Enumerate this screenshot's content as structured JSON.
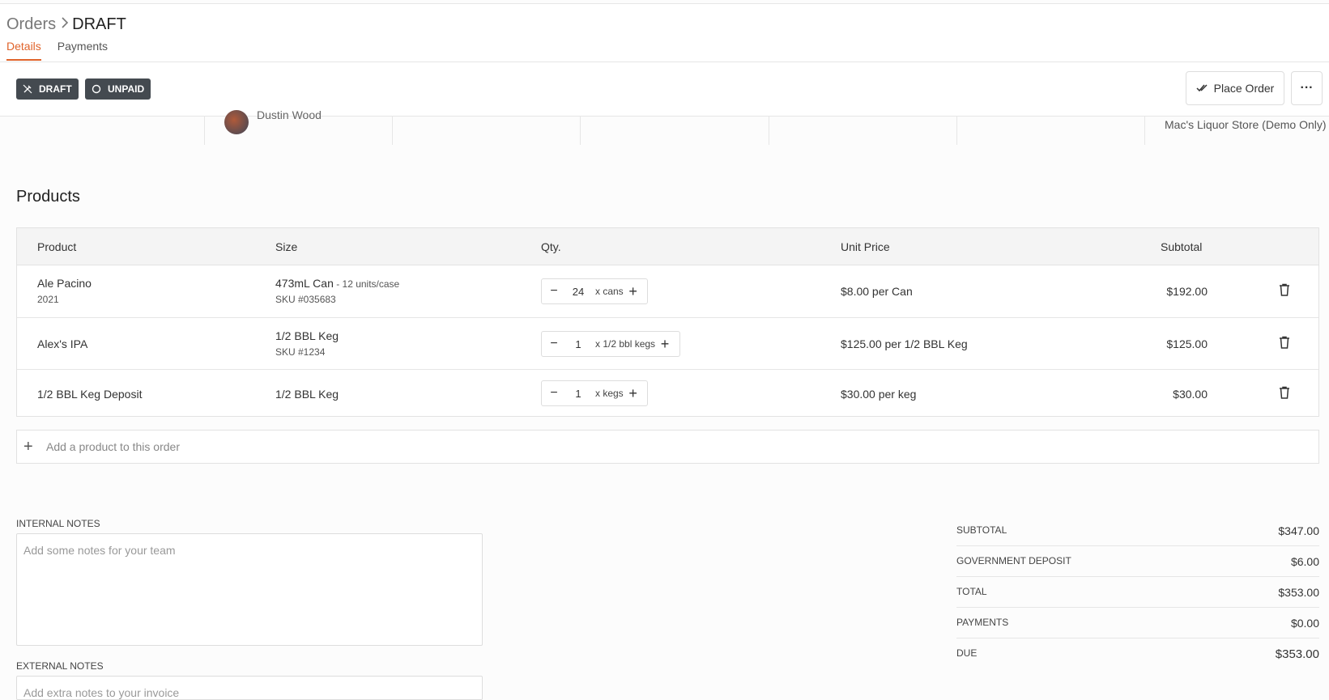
{
  "breadcrumb": {
    "parent": "Orders",
    "separator": "›",
    "current": "DRAFT"
  },
  "tabs": [
    {
      "label": "Details",
      "active": true
    },
    {
      "label": "Payments",
      "active": false
    }
  ],
  "badges": {
    "draft": "DRAFT",
    "unpaid": "UNPAID"
  },
  "actions": {
    "place_order": "Place Order",
    "more": "···"
  },
  "info": {
    "owner": "Dustin Wood",
    "store": "Mac's Liquor Store (Demo Only)"
  },
  "products": {
    "title": "Products",
    "columns": {
      "product": "Product",
      "size": "Size",
      "qty": "Qty.",
      "unit_price": "Unit Price",
      "subtotal": "Subtotal"
    },
    "rows": [
      {
        "name": "Ale Pacino",
        "name_sub": "2021",
        "size": "473mL Can",
        "size_note": " - 12 units/case",
        "sku": "SKU #035683",
        "qty": "24",
        "unit": "x cans",
        "price": "$8.00 per Can",
        "subtotal": "$192.00"
      },
      {
        "name": "Alex's IPA",
        "name_sub": "",
        "size": "1/2 BBL Keg",
        "size_note": "",
        "sku": "SKU #1234",
        "qty": "1",
        "unit": "x 1/2 bbl kegs",
        "price": "$125.00 per 1/2 BBL Keg",
        "subtotal": "$125.00"
      },
      {
        "name": "1/2 BBL Keg Deposit",
        "name_sub": "",
        "size": "1/2 BBL Keg",
        "size_note": "",
        "sku": "",
        "qty": "1",
        "unit": "x kegs",
        "price": "$30.00 per keg",
        "subtotal": "$30.00"
      }
    ],
    "add_placeholder": "Add a product to this order"
  },
  "notes": {
    "internal_label": "INTERNAL NOTES",
    "internal_placeholder": "Add some notes for your team",
    "external_label": "EXTERNAL NOTES",
    "external_placeholder": "Add extra notes to your invoice"
  },
  "summary": [
    {
      "label": "SUBTOTAL",
      "value": "$347.00"
    },
    {
      "label": "GOVERNMENT DEPOSIT",
      "value": "$6.00"
    },
    {
      "label": "TOTAL",
      "value": "$353.00"
    },
    {
      "label": "PAYMENTS",
      "value": "$0.00"
    },
    {
      "label": "DUE",
      "value": "$353.00"
    }
  ],
  "colors": {
    "accent": "#e0632a",
    "badge_bg": "#444a50"
  }
}
